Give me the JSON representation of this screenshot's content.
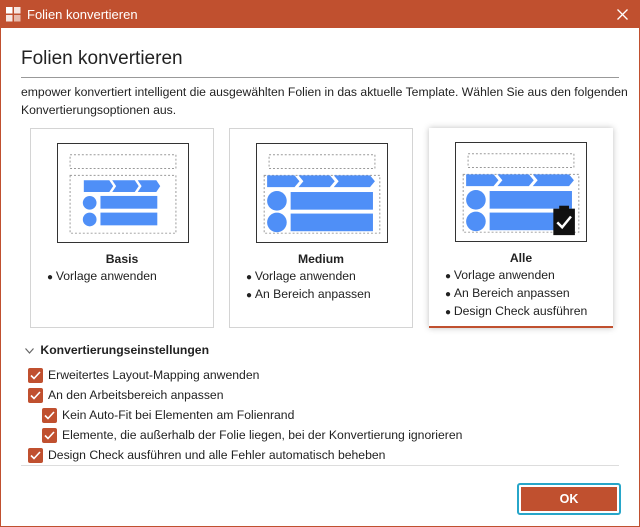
{
  "window": {
    "title": "Folien konvertieren",
    "accent_color": "#c0502f",
    "focus_color": "#27a6c9",
    "diagram_color": "#4f8ff7"
  },
  "dialog": {
    "heading": "Folien konvertieren",
    "intro": "empower konvertiert intelligent die ausgewählten Folien in das aktuelle Template. Wählen Sie aus den folgenden Konvertierungsoptionen aus."
  },
  "cards": [
    {
      "title": "Basis",
      "items": [
        "Vorlage anwenden"
      ],
      "selected": false
    },
    {
      "title": "Medium",
      "items": [
        "Vorlage anwenden",
        "An Bereich anpassen"
      ],
      "selected": false
    },
    {
      "title": "Alle",
      "items": [
        "Vorlage anwenden",
        "An Bereich anpassen",
        "Design Check ausführen"
      ],
      "selected": true
    }
  ],
  "settings": {
    "section_label": "Konvertierungseinstellungen",
    "options": [
      {
        "label": "Erweitertes Layout-Mapping anwenden",
        "checked": true
      },
      {
        "label": "An den Arbeitsbereich anpassen",
        "checked": true
      },
      {
        "label": "Kein Auto-Fit bei Elementen am Folienrand",
        "checked": true
      },
      {
        "label": "Elemente, die außerhalb der Folie liegen, bei der Konvertierung ignorieren",
        "checked": true
      },
      {
        "label": "Design Check ausführen und alle Fehler automatisch beheben",
        "checked": true
      }
    ]
  },
  "footer": {
    "ok_label": "OK"
  }
}
